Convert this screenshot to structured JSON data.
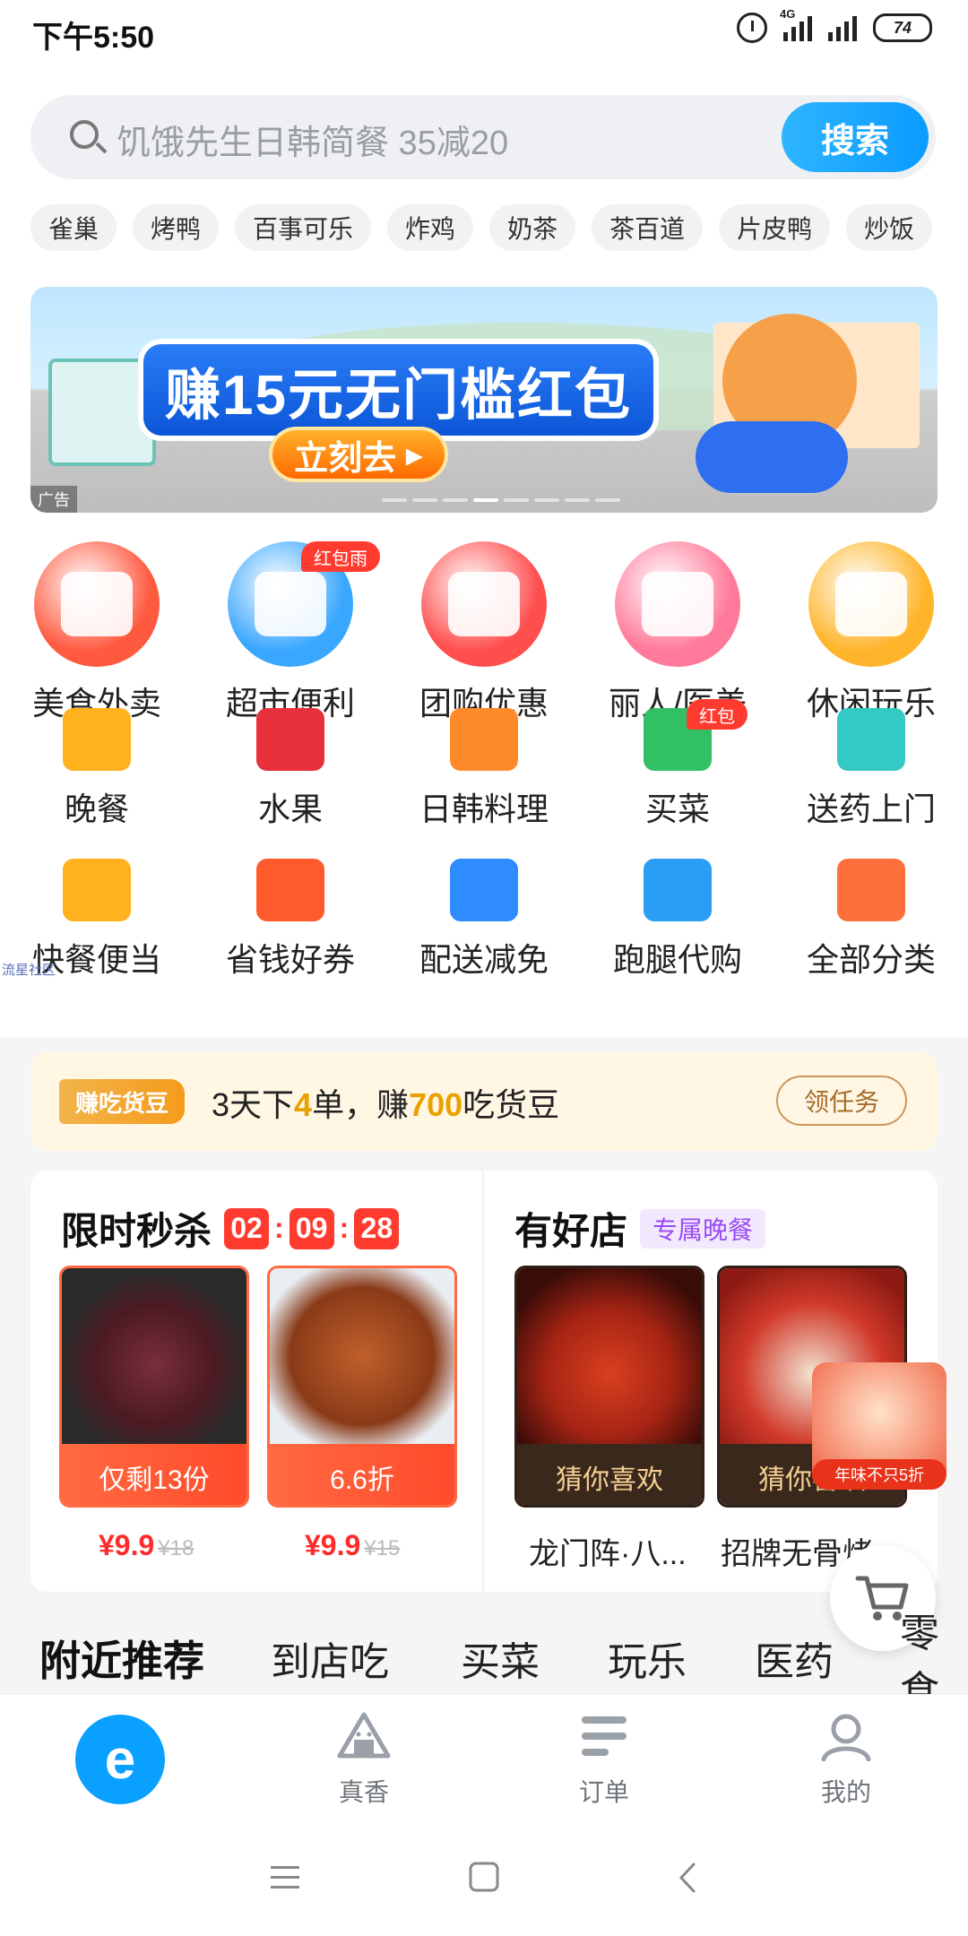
{
  "status": {
    "time": "下午5:50",
    "net_label": "4G",
    "battery": "74"
  },
  "search": {
    "placeholder": "饥饿先生日韩简餐 35减20",
    "button": "搜索"
  },
  "chips": [
    "雀巢",
    "烤鸭",
    "百事可乐",
    "炸鸡",
    "奶茶",
    "茶百道",
    "片皮鸭",
    "炒饭"
  ],
  "banner": {
    "title": "赚15元无门槛红包",
    "cta": "立刻去",
    "ad_label": "广告",
    "slide_count": 8,
    "active_slide": 4
  },
  "big_categories": [
    {
      "label": "美食外卖",
      "color": "#ff5a40",
      "icon": "roast-chicken-icon",
      "tag": ""
    },
    {
      "label": "超市便利",
      "color": "#3aa7ff",
      "icon": "store-icon",
      "tag": "红包雨"
    },
    {
      "label": "团购优惠",
      "color": "#ff4e4e",
      "icon": "coupon-bag-icon",
      "tag": ""
    },
    {
      "label": "丽人/医美",
      "color": "#ff7a9a",
      "icon": "face-icon",
      "tag": ""
    },
    {
      "label": "休闲玩乐",
      "color": "#ffb52b",
      "icon": "gamepad-icon",
      "tag": ""
    }
  ],
  "small_row1": [
    {
      "label": "晚餐",
      "color": "#ffb21d",
      "icon": "bowl-icon",
      "tag": ""
    },
    {
      "label": "水果",
      "color": "#e8303a",
      "icon": "cherry-icon",
      "tag": ""
    },
    {
      "label": "日韩料理",
      "color": "#ff8a2a",
      "icon": "sushi-icon",
      "tag": ""
    },
    {
      "label": "买菜",
      "color": "#32c064",
      "icon": "vegetable-basket-icon",
      "tag": "红包"
    },
    {
      "label": "送药上门",
      "color": "#33c9c4",
      "icon": "medicine-box-icon",
      "tag": ""
    }
  ],
  "small_row2": [
    {
      "label": "快餐便当",
      "color": "#ffb21d",
      "icon": "lunch-box-icon",
      "tag": ""
    },
    {
      "label": "省钱好券",
      "color": "#ff5a2c",
      "icon": "yen-coupon-icon",
      "tag": ""
    },
    {
      "label": "配送减免",
      "color": "#2f8cff",
      "icon": "scooter-icon",
      "tag": ""
    },
    {
      "label": "跑腿代购",
      "color": "#2a9df4",
      "icon": "shopping-bag-icon",
      "tag": ""
    },
    {
      "label": "全部分类",
      "color": "#ff6f3c",
      "icon": "all-categories-icon",
      "tag": ""
    }
  ],
  "watermark": "流星社区",
  "task": {
    "tag": "赚吃货豆",
    "text_a": "3天下",
    "num_a": "4",
    "text_b": "单，赚",
    "num_b": "700",
    "text_c": "吃货豆",
    "button": "领任务"
  },
  "flash_sale": {
    "title": "限时秒杀",
    "countdown": [
      "02",
      "09",
      "28"
    ],
    "items": [
      {
        "caption": "仅剩13份",
        "price": "¥9.9",
        "orig": "¥18"
      },
      {
        "caption": "6.6折",
        "price": "¥9.9",
        "orig": "¥15"
      }
    ]
  },
  "good_shops": {
    "title": "有好店",
    "badge": "专属晚餐",
    "items": [
      {
        "caption": "猜你喜欢",
        "name": "龙门阵·八..."
      },
      {
        "caption": "猜你喜欢",
        "name": "招牌无骨烤..."
      }
    ]
  },
  "float_ad": "年味不只5折",
  "tabs": [
    "附近推荐",
    "到店吃",
    "买菜",
    "玩乐",
    "医药",
    "零食"
  ],
  "bottom_nav": [
    {
      "label": "真香",
      "icon": "onigiri-icon"
    },
    {
      "label": "订单",
      "icon": "order-list-icon"
    },
    {
      "label": "我的",
      "icon": "profile-icon"
    }
  ]
}
